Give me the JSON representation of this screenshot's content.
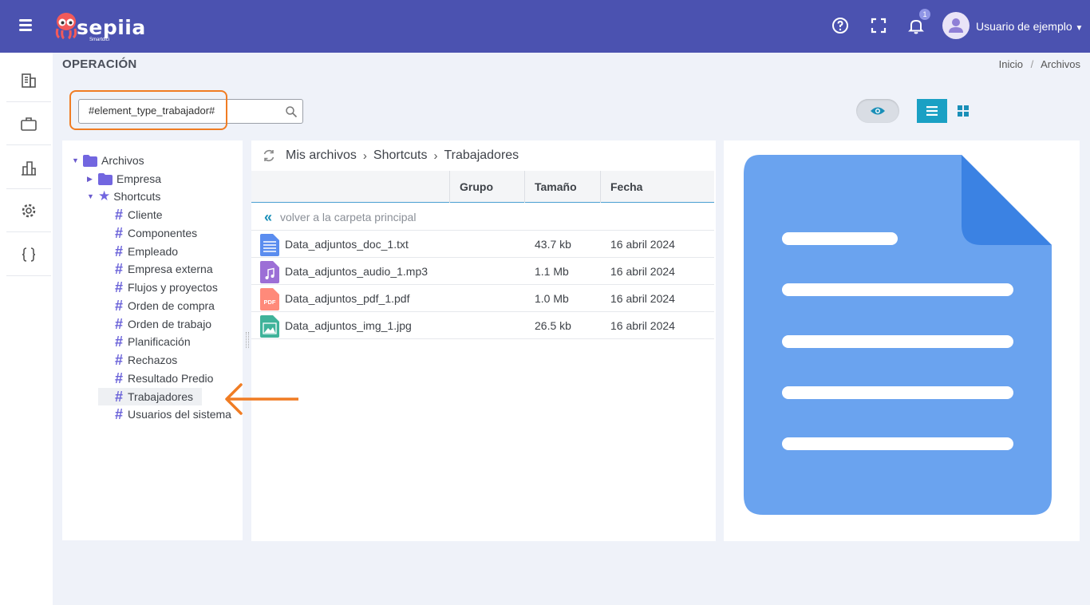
{
  "header": {
    "logo_text": "sepiia",
    "logo_sub": "Smartdici",
    "notification_count": "1",
    "user_name": "Usuario de ejemplo",
    "icons": [
      "help-icon",
      "fullscreen-icon",
      "bell-icon",
      "user-avatar-icon"
    ],
    "accent_color": "#4b52b0"
  },
  "sidebar": {
    "items": [
      "building-icon",
      "briefcase-icon",
      "city-icon",
      "gear-icon",
      "braces-icon"
    ]
  },
  "page": {
    "title": "OPERACIÓN",
    "breadcrumb": [
      "Inicio",
      "Archivos"
    ]
  },
  "search": {
    "value": "#element_type_trabajador#"
  },
  "tree": {
    "root": "Archivos",
    "empresa": "Empresa",
    "shortcuts": "Shortcuts",
    "children": [
      "Cliente",
      "Componentes",
      "Empleado",
      "Empresa externa",
      "Flujos y proyectos",
      "Orden de compra",
      "Orden de trabajo",
      "Planificación",
      "Rechazos",
      "Resultado Predio",
      "Trabajadores",
      "Usuarios del sistema"
    ],
    "selected": "Trabajadores"
  },
  "files": {
    "path": [
      "Mis archivos",
      "Shortcuts",
      "Trabajadores"
    ],
    "columns": [
      "Grupo",
      "Tamaño",
      "Fecha"
    ],
    "back_label": "volver a la carpeta principal",
    "rows": [
      {
        "name": "Data_adjuntos_doc_1.txt",
        "size": "43.7 kb",
        "date": "16 abril 2024",
        "type": "doc"
      },
      {
        "name": "Data_adjuntos_audio_1.mp3",
        "size": "1.1 Mb",
        "date": "16 abril 2024",
        "type": "audio"
      },
      {
        "name": "Data_adjuntos_pdf_1.pdf",
        "size": "1.0 Mb",
        "date": "16 abril 2024",
        "type": "pdf",
        "icon_label": "PDF"
      },
      {
        "name": "Data_adjuntos_img_1.jpg",
        "size": "26.5 kb",
        "date": "16 abril 2024",
        "type": "image"
      }
    ]
  },
  "colors": {
    "highlight": "#f07c23",
    "list_view": "#1aa0c4",
    "doc_preview": "#6aa3ef"
  }
}
